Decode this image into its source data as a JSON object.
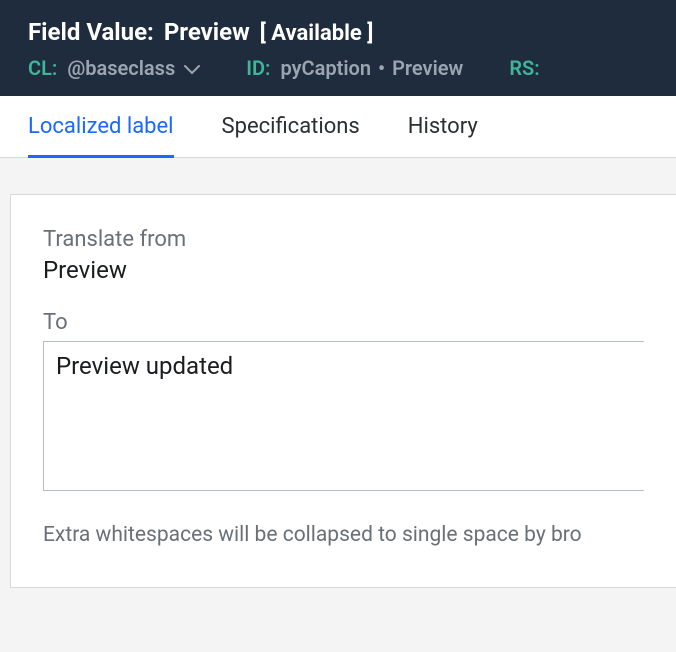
{
  "header": {
    "title_label": "Field Value:",
    "title_value": "Preview",
    "status": "[ Available ]",
    "meta": {
      "cl_key": "CL:",
      "cl_val": "@baseclass",
      "id_key": "ID:",
      "id_val_1": "pyCaption",
      "id_sep": "•",
      "id_val_2": "Preview",
      "rs_key": "RS:"
    }
  },
  "tabs": {
    "t0": "Localized label",
    "t1": "Specifications",
    "t2": "History"
  },
  "form": {
    "translate_from_label": "Translate from",
    "translate_from_value": "Preview",
    "to_label": "To",
    "to_value": "Preview updated",
    "help_text": "Extra whitespaces will be collapsed to single space by bro"
  }
}
